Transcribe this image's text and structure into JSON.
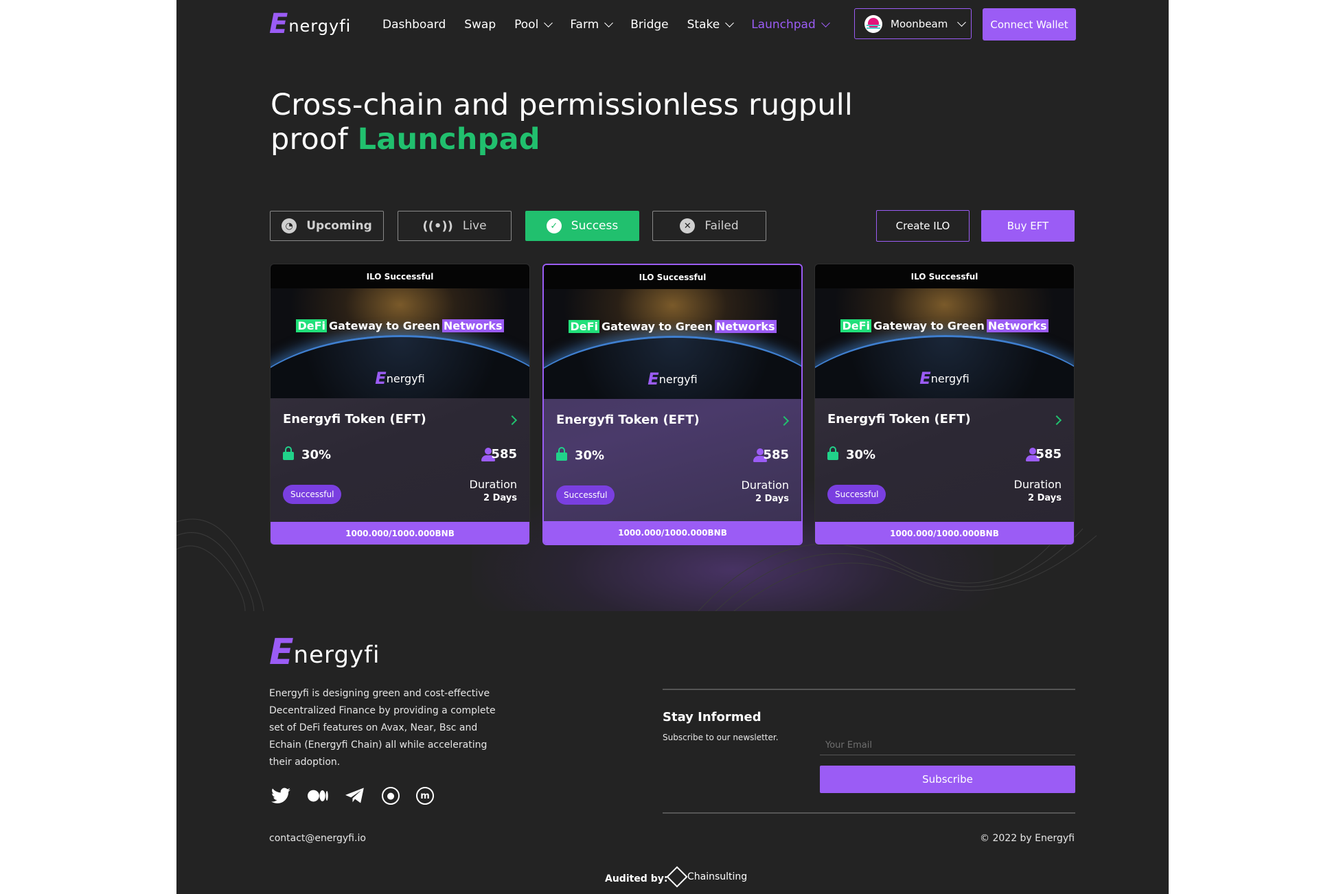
{
  "brand": {
    "logo_mark": "E",
    "logo_word": "nergyfi"
  },
  "nav": {
    "items": [
      {
        "label": "Dashboard",
        "has_dropdown": false
      },
      {
        "label": "Swap",
        "has_dropdown": false
      },
      {
        "label": "Pool",
        "has_dropdown": true
      },
      {
        "label": "Farm",
        "has_dropdown": true
      },
      {
        "label": "Bridge",
        "has_dropdown": false
      },
      {
        "label": "Stake",
        "has_dropdown": true
      },
      {
        "label": "Launchpad",
        "has_dropdown": true,
        "active": true
      }
    ],
    "network": "Moonbeam",
    "connect_label": "Connect Wallet"
  },
  "hero": {
    "line1": "Cross-chain and permissionless rugpull",
    "line2_prefix": "proof ",
    "line2_accent": "Launchpad"
  },
  "tabs": [
    {
      "label": "Upcoming",
      "icon": "clock-icon",
      "active": false
    },
    {
      "label": "Live",
      "icon": "broadcast-icon",
      "active": false
    },
    {
      "label": "Success",
      "icon": "check-circle-icon",
      "active": true
    },
    {
      "label": "Failed",
      "icon": "x-circle-icon",
      "active": false
    }
  ],
  "actions": {
    "create_ilo": "Create ILO",
    "buy_eft": "Buy EFT"
  },
  "cards": [
    {
      "status_header": "ILO Successful",
      "banner": {
        "defi": "DeFi",
        "middle": "Gateway to Green",
        "networks": "Networks",
        "logo_mark": "E",
        "logo_word": "nergyfi"
      },
      "token": "Energyfi Token (EFT)",
      "locked_pct": "30%",
      "participants": "585",
      "badge": "Successful",
      "duration_label": "Duration",
      "duration_value": "2 Days",
      "raised": "1000.000/1000.000BNB"
    },
    {
      "status_header": "ILO Successful",
      "banner": {
        "defi": "DeFi",
        "middle": "Gateway to Green",
        "networks": "Networks",
        "logo_mark": "E",
        "logo_word": "nergyfi"
      },
      "token": "Energyfi Token (EFT)",
      "locked_pct": "30%",
      "participants": "585",
      "badge": "Successful",
      "duration_label": "Duration",
      "duration_value": "2 Days",
      "raised": "1000.000/1000.000BNB"
    },
    {
      "status_header": "ILO Successful",
      "banner": {
        "defi": "DeFi",
        "middle": "Gateway to Green",
        "networks": "Networks",
        "logo_mark": "E",
        "logo_word": "nergyfi"
      },
      "token": "Energyfi Token (EFT)",
      "locked_pct": "30%",
      "participants": "585",
      "badge": "Successful",
      "duration_label": "Duration",
      "duration_value": "2 Days",
      "raised": "1000.000/1000.000BNB"
    }
  ],
  "footer": {
    "logo_mark": "E",
    "logo_word": "nergyfi",
    "description": "Energyfi is designing green and cost-effective Decentralized Finance by providing a complete set of DeFi features on Avax, Near, Bsc and Echain (Energyfi Chain) all while accelerating their adoption.",
    "socials": [
      "twitter-icon",
      "medium-icon",
      "telegram-icon",
      "coingecko-icon",
      "coinmarketcap-icon"
    ],
    "newsletter_title": "Stay Informed",
    "newsletter_sub": "Subscribe to our newsletter.",
    "email_placeholder": "Your Email",
    "subscribe_label": "Subscribe",
    "contact": "contact@energyfi.io",
    "copyright": "© 2022 by Energyfi",
    "audited_label": "Audited by:",
    "auditor": "Chainsulting"
  },
  "colors": {
    "purple": "#9b5cf5",
    "green": "#21c06e",
    "bg": "#232323"
  }
}
